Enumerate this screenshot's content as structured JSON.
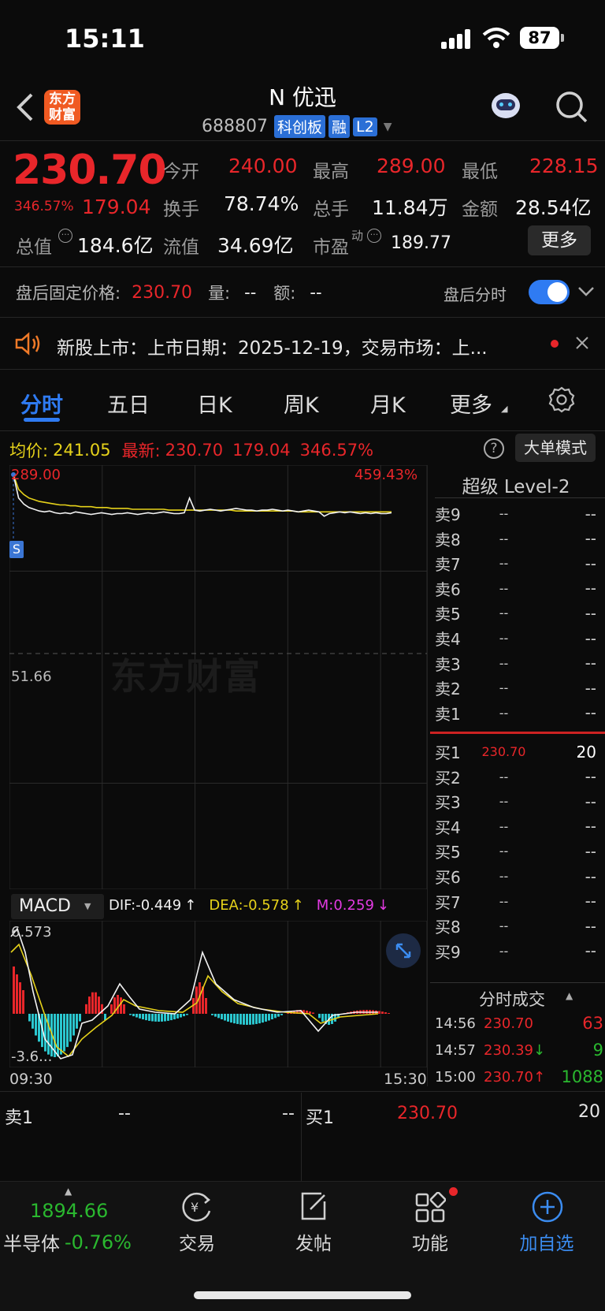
{
  "status": {
    "time": "15:11",
    "battery": "87"
  },
  "header": {
    "logo": "东方\n财富",
    "logo_line1": "东方",
    "logo_line2": "财富",
    "name": "N 优迅",
    "code": "688807",
    "tag_board": "科创板",
    "tag_margin": "融",
    "tag_level": "L2"
  },
  "quote": {
    "price": "230.70",
    "pct": "346.57%",
    "chg": "179.04",
    "open_label": "今开",
    "open": "240.00",
    "high_label": "最高",
    "high": "289.00",
    "low_label": "最低",
    "low": "228.15",
    "turnover_label": "换手",
    "turnover": "78.74%",
    "volume_label": "总手",
    "volume": "11.84万",
    "amount_label": "金额",
    "amount": "28.54亿",
    "mktcap_label": "总值",
    "mktcap": "184.6亿",
    "float_label": "流值",
    "float": "34.69亿",
    "pe_label": "市盈",
    "pe_sup": "动",
    "pe": "189.77",
    "more": "更多"
  },
  "after_hours": {
    "label": "盘后固定价格:",
    "price": "230.70",
    "vol_label": "量:",
    "vol": "--",
    "amt_label": "额:",
    "amt": "--",
    "toggle_label": "盘后分时",
    "toggle_on": true
  },
  "notice": {
    "text": "新股上市：上市日期：2025-12-19，交易市场：上..."
  },
  "tabs": [
    "分时",
    "五日",
    "日K",
    "周K",
    "月K",
    "更多"
  ],
  "active_tab": "分时",
  "info_bar": {
    "avg_label": "均价:",
    "avg": "241.05",
    "latest_label": "最新:",
    "latest": "230.70",
    "chg": "179.04",
    "pct": "346.57%",
    "mode": "大单模式"
  },
  "chart": {
    "top_price": "289.00",
    "top_pct": "459.43%",
    "mid_price": "51.66",
    "s_marker": "S",
    "watermark": "东方财富",
    "time_start": "09:30",
    "time_end": "15:30",
    "price_series": [
      289,
      262,
      255,
      251,
      249,
      247,
      246,
      247,
      245,
      244,
      245,
      244,
      246,
      245,
      244,
      243,
      244,
      245,
      244,
      243,
      244,
      244,
      245,
      244,
      243,
      244,
      245,
      244,
      245,
      246,
      245,
      244,
      244,
      245,
      262,
      248,
      247,
      248,
      249,
      248,
      247,
      248,
      249,
      250,
      249,
      248,
      248,
      247,
      248,
      248,
      249,
      248,
      247,
      248,
      247,
      246,
      247,
      248,
      247,
      246,
      241,
      244,
      245,
      246,
      245,
      246,
      245,
      244,
      245,
      244,
      245,
      244,
      244,
      245
    ],
    "avg_series": [
      289,
      272,
      266,
      262,
      260,
      258,
      257,
      256,
      255,
      254,
      254,
      253,
      253,
      252,
      252,
      252,
      251,
      251,
      251,
      250,
      250,
      250,
      250,
      249,
      249,
      249,
      249,
      249,
      249,
      249,
      248,
      248,
      248,
      248,
      248,
      248,
      248,
      248,
      248,
      248,
      248,
      248,
      248,
      247,
      247,
      247,
      247,
      247,
      247,
      247,
      247,
      247,
      247,
      247,
      247,
      246,
      246,
      246,
      246,
      246,
      246,
      246,
      246,
      246,
      246,
      246,
      246,
      246,
      246,
      246,
      246,
      246,
      246,
      246
    ],
    "ymin": 0,
    "ymax": 289
  },
  "macd": {
    "label": "MACD",
    "dif_label": "DIF:",
    "dif": "-0.449",
    "dea_label": "DEA:",
    "dea": "-0.578",
    "m_label": "M:",
    "m": "0.259",
    "top": "6.573",
    "bottom": "-3.6..."
  },
  "level2": {
    "title": "超级 Level-2",
    "asks": [
      {
        "l": "卖9",
        "p": "--",
        "v": "--"
      },
      {
        "l": "卖8",
        "p": "--",
        "v": "--"
      },
      {
        "l": "卖7",
        "p": "--",
        "v": "--"
      },
      {
        "l": "卖6",
        "p": "--",
        "v": "--"
      },
      {
        "l": "卖5",
        "p": "--",
        "v": "--"
      },
      {
        "l": "卖4",
        "p": "--",
        "v": "--"
      },
      {
        "l": "卖3",
        "p": "--",
        "v": "--"
      },
      {
        "l": "卖2",
        "p": "--",
        "v": "--"
      },
      {
        "l": "卖1",
        "p": "--",
        "v": "--"
      }
    ],
    "bids": [
      {
        "l": "买1",
        "p": "230.70",
        "v": "20"
      },
      {
        "l": "买2",
        "p": "--",
        "v": "--"
      },
      {
        "l": "买3",
        "p": "--",
        "v": "--"
      },
      {
        "l": "买4",
        "p": "--",
        "v": "--"
      },
      {
        "l": "买5",
        "p": "--",
        "v": "--"
      },
      {
        "l": "买6",
        "p": "--",
        "v": "--"
      },
      {
        "l": "买7",
        "p": "--",
        "v": "--"
      },
      {
        "l": "买8",
        "p": "--",
        "v": "--"
      },
      {
        "l": "买9",
        "p": "--",
        "v": "--"
      }
    ]
  },
  "ticks": {
    "title": "分时成交",
    "rows": [
      {
        "t": "14:56",
        "p": "230.70",
        "arrow": "",
        "v": "63"
      },
      {
        "t": "14:57",
        "p": "230.39",
        "arrow": "↓",
        "v": "9"
      },
      {
        "t": "15:00",
        "p": "230.70",
        "arrow": "↑",
        "v": "1088"
      }
    ]
  },
  "bottom_book": {
    "ask_label": "卖1",
    "ask_p": "--",
    "ask_v": "--",
    "bid_label": "买1",
    "bid_p": "230.70",
    "bid_v": "20"
  },
  "nav": {
    "index_value": "1894.66",
    "index_name": "半导体",
    "index_pct": "-0.76%",
    "trade": "交易",
    "post": "发帖",
    "func": "功能",
    "add": "加自选"
  }
}
